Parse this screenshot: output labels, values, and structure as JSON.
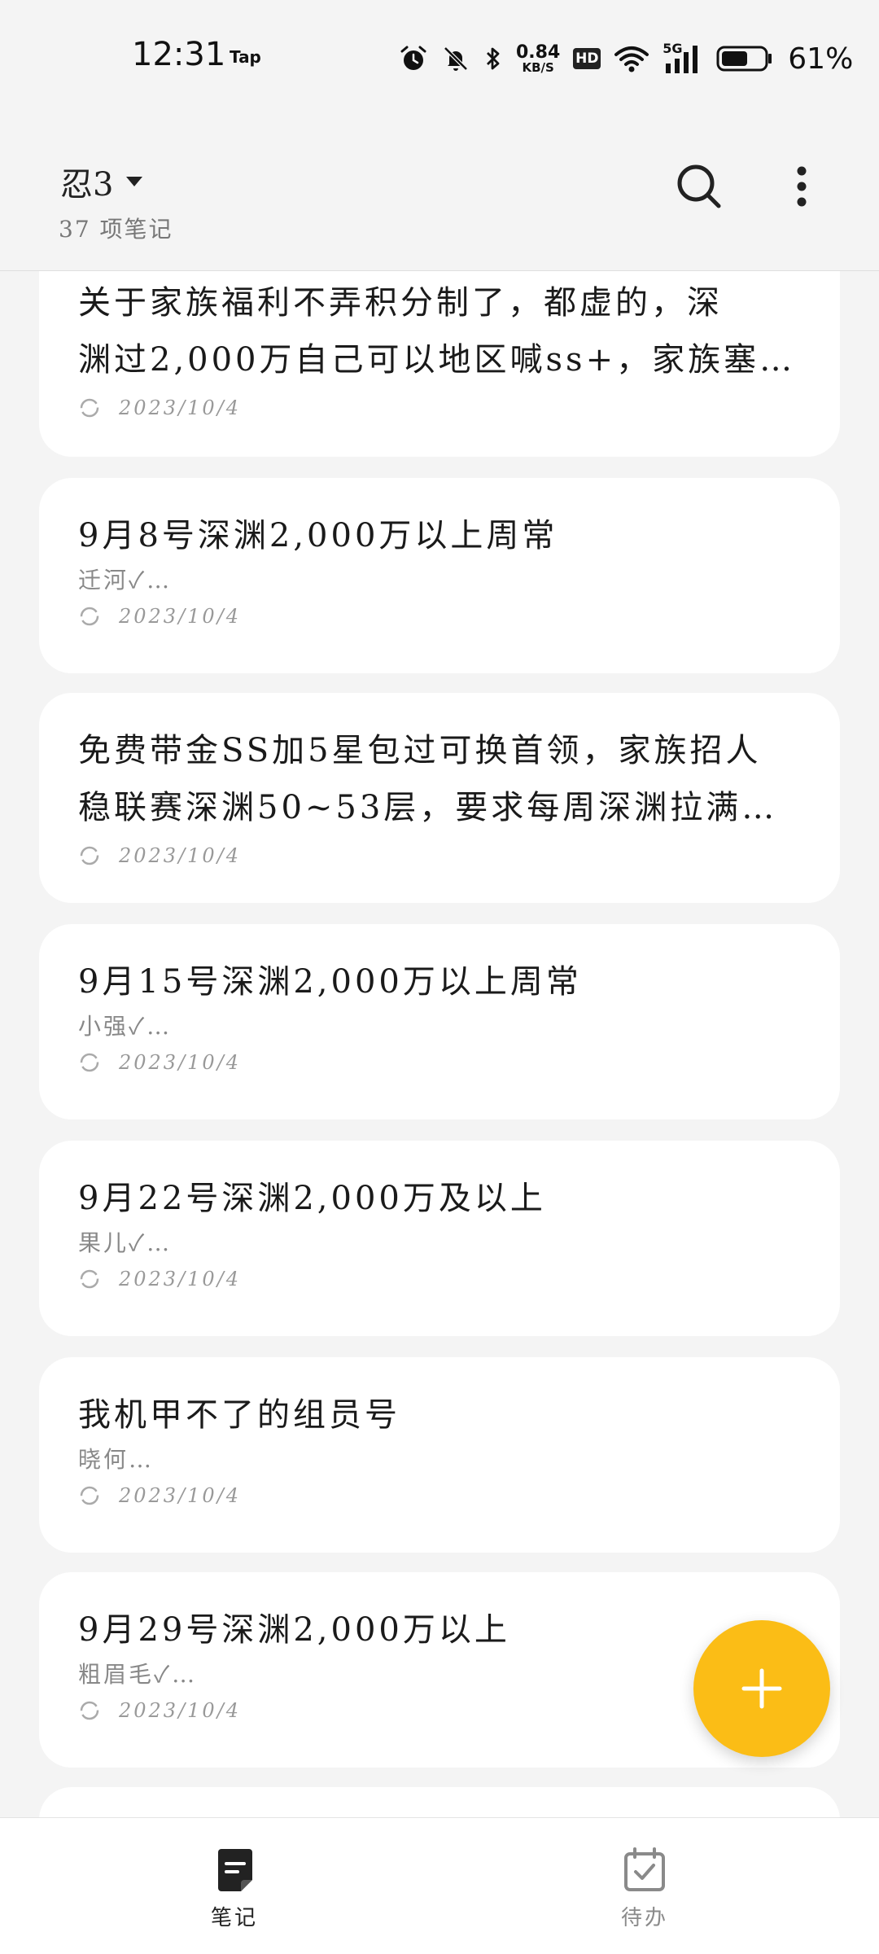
{
  "status_bar": {
    "time": "12:31",
    "tap_label": "Tap",
    "net_speed_value": "0.84",
    "net_speed_unit": "KB/S",
    "hd_label": "HD",
    "network_label": "5G",
    "battery_percent": "61%",
    "battery_level": 0.61
  },
  "header": {
    "folder_name": "忍3",
    "note_count": "37 项笔记"
  },
  "notes": [
    {
      "title_line1": "关于家族福利不弄积分制了，都虚的，深",
      "title_line2": "渊过2,000万自己可以地区喊ss+，家族塞…",
      "snippet": "",
      "date": "2023/10/4"
    },
    {
      "title_line1": "9月8号深渊2,000万以上周常",
      "title_line2": "",
      "snippet": "迁河✓…",
      "date": "2023/10/4"
    },
    {
      "title_line1": "免费带金SS加5星包过可换首领，家族招人",
      "title_line2": "稳联赛深渊50~53层，要求每周深渊拉满…",
      "snippet": "",
      "date": "2023/10/4"
    },
    {
      "title_line1": "9月15号深渊2,000万以上周常",
      "title_line2": "",
      "snippet": "小强✓…",
      "date": "2023/10/4"
    },
    {
      "title_line1": "9月22号深渊2,000万及以上",
      "title_line2": "",
      "snippet": "果儿✓…",
      "date": "2023/10/4"
    },
    {
      "title_line1": "我机甲不了的组员号",
      "title_line2": "",
      "snippet": "晓何…",
      "date": "2023/10/4"
    },
    {
      "title_line1": "9月29号深渊2,000万以上",
      "title_line2": "",
      "snippet": "粗眉毛✓…",
      "date": "2023/10/4"
    }
  ],
  "bottom_nav": {
    "notes_label": "笔记",
    "todo_label": "待办"
  },
  "colors": {
    "accent": "#fbbd16",
    "active_nav": "#222222",
    "inactive_nav": "#8a8a8a"
  }
}
